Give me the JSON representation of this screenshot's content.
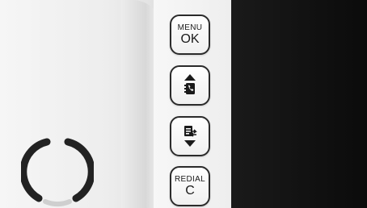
{
  "buttons": {
    "menu_ok": {
      "line1": "MENU",
      "line2": "OK"
    },
    "phonebook_up": {
      "icon": "phonebook-up-arrow-icon"
    },
    "call_list_down": {
      "icon": "call-list-down-arrow-icon"
    },
    "redial_c": {
      "line1": "REDIAL",
      "line2": "C"
    }
  },
  "decor": {
    "ring_icon": "speaker-ring-icon",
    "screen_color": "#141414"
  }
}
